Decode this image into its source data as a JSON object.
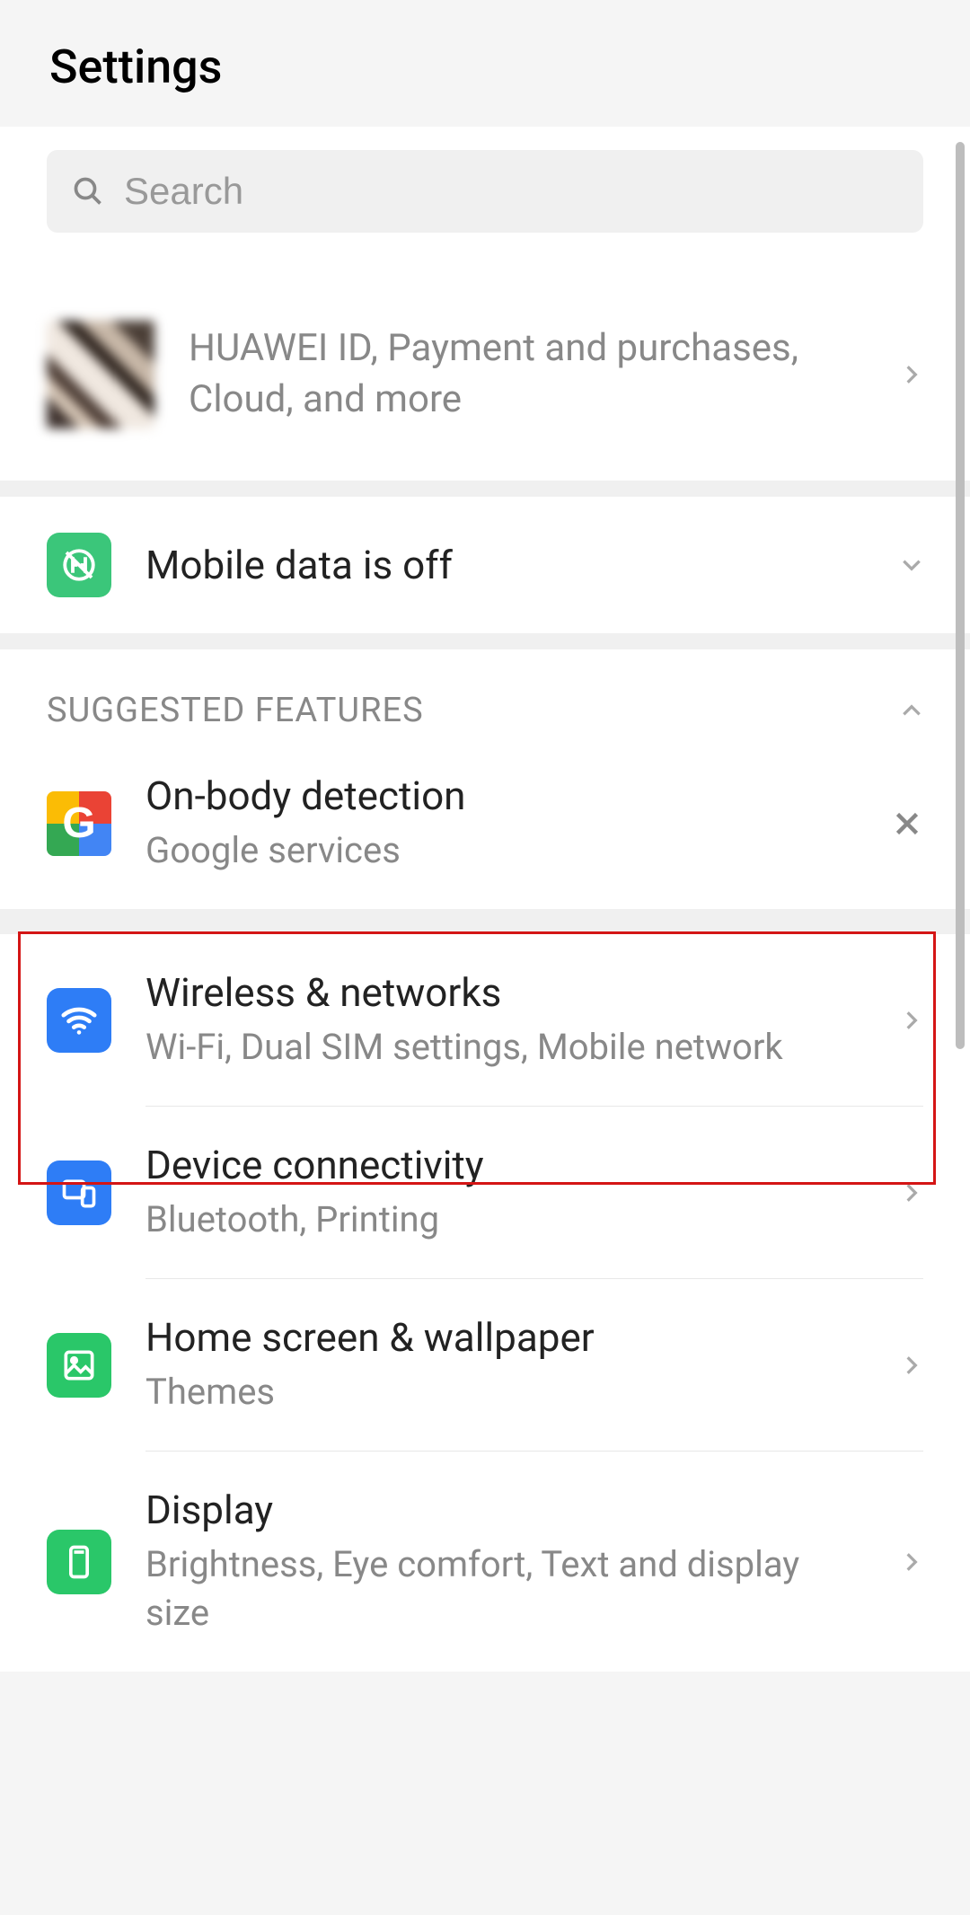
{
  "header": {
    "title": "Settings"
  },
  "search": {
    "placeholder": "Search"
  },
  "account": {
    "text": "HUAWEI ID, Payment and purchases, Cloud, and more"
  },
  "mobile_data": {
    "title": "Mobile data is off"
  },
  "suggested": {
    "header": "SUGGESTED FEATURES",
    "items": [
      {
        "title": "On-body detection",
        "sub": "Google services"
      }
    ]
  },
  "menu": [
    {
      "title": "Wireless & networks",
      "sub": "Wi-Fi, Dual SIM settings, Mobile network"
    },
    {
      "title": "Device connectivity",
      "sub": "Bluetooth, Printing"
    },
    {
      "title": "Home screen & wallpaper",
      "sub": "Themes"
    },
    {
      "title": "Display",
      "sub": "Brightness, Eye comfort, Text and display size"
    }
  ],
  "colors": {
    "highlight": "#d41515",
    "icon_green": "#3bc67a",
    "icon_blue": "#2e7df6"
  }
}
